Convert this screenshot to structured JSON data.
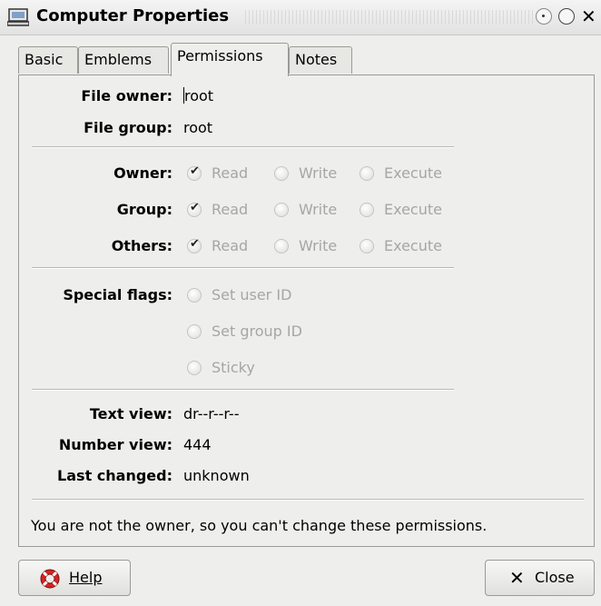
{
  "window": {
    "title": "Computer Properties"
  },
  "tabs": [
    {
      "label": "Basic"
    },
    {
      "label": "Emblems"
    },
    {
      "label": "Permissions"
    },
    {
      "label": "Notes"
    }
  ],
  "file_owner": {
    "label": "File owner:",
    "value": "root"
  },
  "file_group": {
    "label": "File group:",
    "value": "root"
  },
  "permissions": [
    {
      "label": "Owner:",
      "read": "Read",
      "write": "Write",
      "execute": "Execute"
    },
    {
      "label": "Group:",
      "read": "Read",
      "write": "Write",
      "execute": "Execute"
    },
    {
      "label": "Others:",
      "read": "Read",
      "write": "Write",
      "execute": "Execute"
    }
  ],
  "special_flags": {
    "label": "Special flags:",
    "set_user_id": "Set user ID",
    "set_group_id": "Set group ID",
    "sticky": "Sticky"
  },
  "text_view": {
    "label": "Text view:",
    "value": "dr--r--r--"
  },
  "number_view": {
    "label": "Number view:",
    "value": "444"
  },
  "last_changed": {
    "label": "Last changed:",
    "value": "unknown"
  },
  "message": "You are not the owner, so you can't change these permissions.",
  "buttons": {
    "help": "Help",
    "close": "Close"
  }
}
